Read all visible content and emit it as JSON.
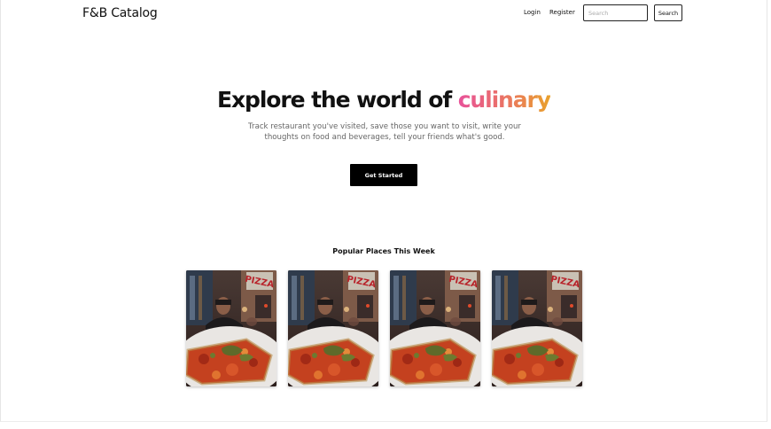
{
  "navbar": {
    "brand": "F&B Catalog",
    "login_label": "Login",
    "register_label": "Register",
    "search_placeholder": "Search",
    "search_button_label": "Search"
  },
  "hero": {
    "title_prefix": "Explore the world of",
    "title_accent": "culinary",
    "subtitle": "Track restaurant you've visited, save those you want to visit, write your thoughts on food and beverages, tell your friends what's good.",
    "cta_label": "Get Started",
    "accent_gradient": [
      "#e8529a",
      "#ea6f6a",
      "#e9a12c"
    ]
  },
  "popular": {
    "title": "Popular Places This Week",
    "cards": [
      {
        "image": "pizza-photo",
        "sign_text": "PIZZA"
      },
      {
        "image": "pizza-photo",
        "sign_text": "PIZZA"
      },
      {
        "image": "pizza-photo",
        "sign_text": "PIZZA"
      },
      {
        "image": "pizza-photo",
        "sign_text": "PIZZA"
      }
    ]
  }
}
